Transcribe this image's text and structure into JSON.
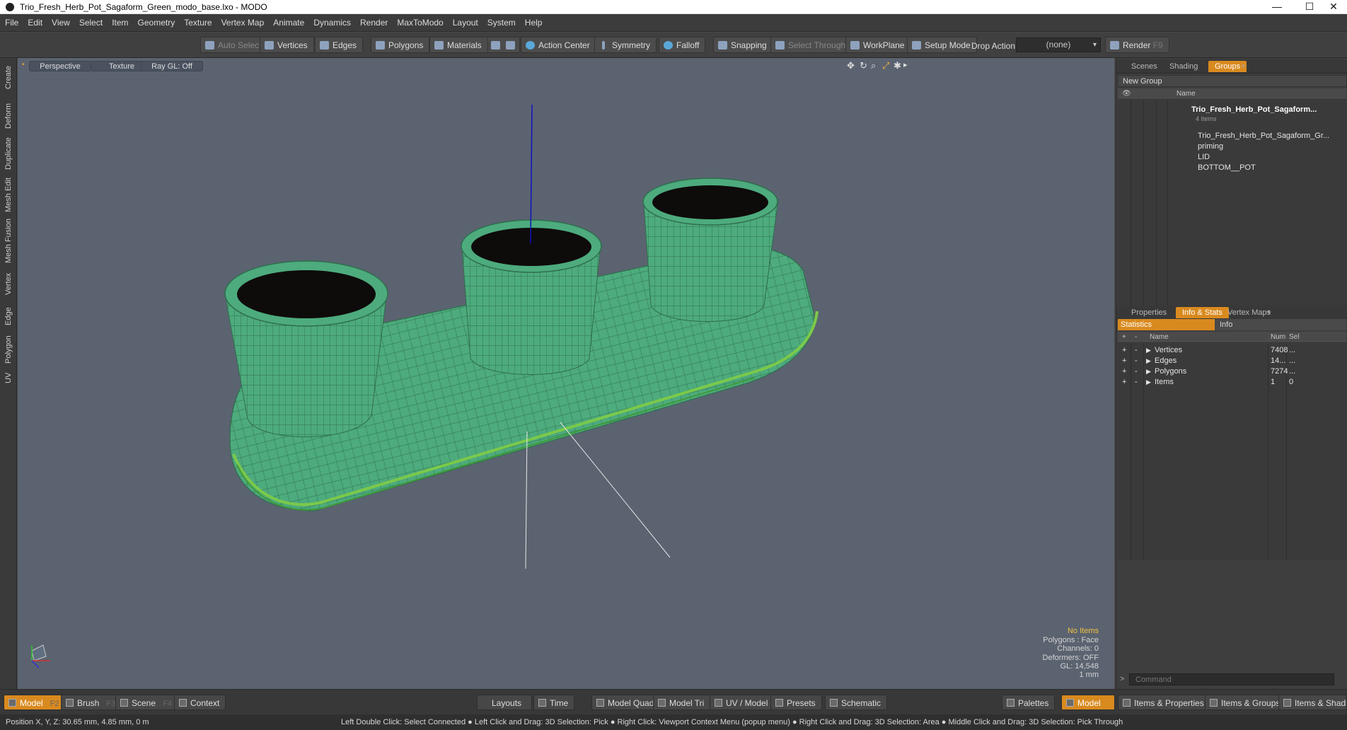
{
  "window": {
    "title": "Trio_Fresh_Herb_Pot_Sagaform_Green_modo_base.lxo - MODO",
    "controls": [
      "—",
      "☐",
      "✕"
    ]
  },
  "menu": [
    "File",
    "Edit",
    "View",
    "Select",
    "Item",
    "Geometry",
    "Texture",
    "Vertex Map",
    "Animate",
    "Dynamics",
    "Render",
    "MaxToModo",
    "Layout",
    "System",
    "Help"
  ],
  "toolbar": {
    "auto_select": "Auto Select",
    "vertices": "Vertices",
    "edges": "Edges",
    "polygons": "Polygons",
    "materials": "Materials",
    "action_center": "Action Center",
    "symmetry": "Symmetry",
    "falloff": "Falloff",
    "snapping": "Snapping",
    "select_through": "Select Through",
    "workplane": "WorkPlane",
    "setup_mode": "Setup Mode",
    "drop_action": "Drop Action",
    "drop_value": "(none)",
    "render": "Render",
    "render_key": "F9"
  },
  "left_tabs": [
    "Create",
    "Deform",
    "Duplicate",
    "Mesh Edit",
    "Mesh Fusion",
    "Vertex",
    "Edge",
    "Polygon",
    "UV"
  ],
  "viewport": {
    "view": "Perspective",
    "shading": "Texture",
    "raygl": "Ray GL: Off",
    "info": {
      "no_items": "No Items",
      "polygons": "Polygons : Face",
      "channels": "Channels: 0",
      "deformers": "Deformers: OFF",
      "gl": "GL: 14,548",
      "unit": "1 mm"
    }
  },
  "groups_panel": {
    "tabs": [
      "Scenes",
      "Shading",
      "Groups"
    ],
    "new_group": "New Group",
    "col_name": "Name",
    "root": "Trio_Fresh_Herb_Pot_Sagaform...",
    "root_sub": "4 Items",
    "children": [
      "Trio_Fresh_Herb_Pot_Sagaform_Gr...",
      "priming",
      "LID",
      "BOTTOM__POT"
    ]
  },
  "stats_panel": {
    "tabs": [
      "Properties",
      "Info & Stats",
      "Vertex Maps"
    ],
    "sub_tabs": [
      "Statistics",
      "Info"
    ],
    "cols": [
      "Name",
      "Num",
      "Sel"
    ],
    "rows": [
      {
        "name": "Vertices",
        "num": "7408",
        "sel": "..."
      },
      {
        "name": "Edges",
        "num": "14...",
        "sel": "..."
      },
      {
        "name": "Polygons",
        "num": "7274",
        "sel": "..."
      },
      {
        "name": "Items",
        "num": "1",
        "sel": "0"
      }
    ],
    "command_placeholder": "Command"
  },
  "bottom": {
    "model": "Model",
    "model_key": "F2",
    "brush": "Brush",
    "brush_key": "F3",
    "scene": "Scene",
    "scene_key": "F4",
    "context": "Context",
    "layouts": "Layouts",
    "time": "Time",
    "model_quad": "Model Quad",
    "model_tri": "Model Tri",
    "uv_model": "UV / Model",
    "presets": "Presets",
    "schematic": "Schematic",
    "palettes": "Palettes",
    "model2": "Model",
    "items_props": "Items & Properties",
    "items_groups": "Items & Groups",
    "items_shading": "Items & Shading"
  },
  "status": {
    "position": "Position X, Y, Z:   30.65 mm, 4.85 mm, 0 m",
    "hint": "Left Double Click: Select Connected ● Left Click and Drag: 3D Selection: Pick ● Right Click: Viewport Context Menu (popup menu) ● Right Click and Drag: 3D Selection: Area ● Middle Click and Drag: 3D Selection: Pick Through"
  },
  "colors": {
    "accent": "#d98a1f",
    "mesh": "#4daa7c",
    "soil": "#0e0b0b",
    "viewport_bg": "#5b6370"
  }
}
